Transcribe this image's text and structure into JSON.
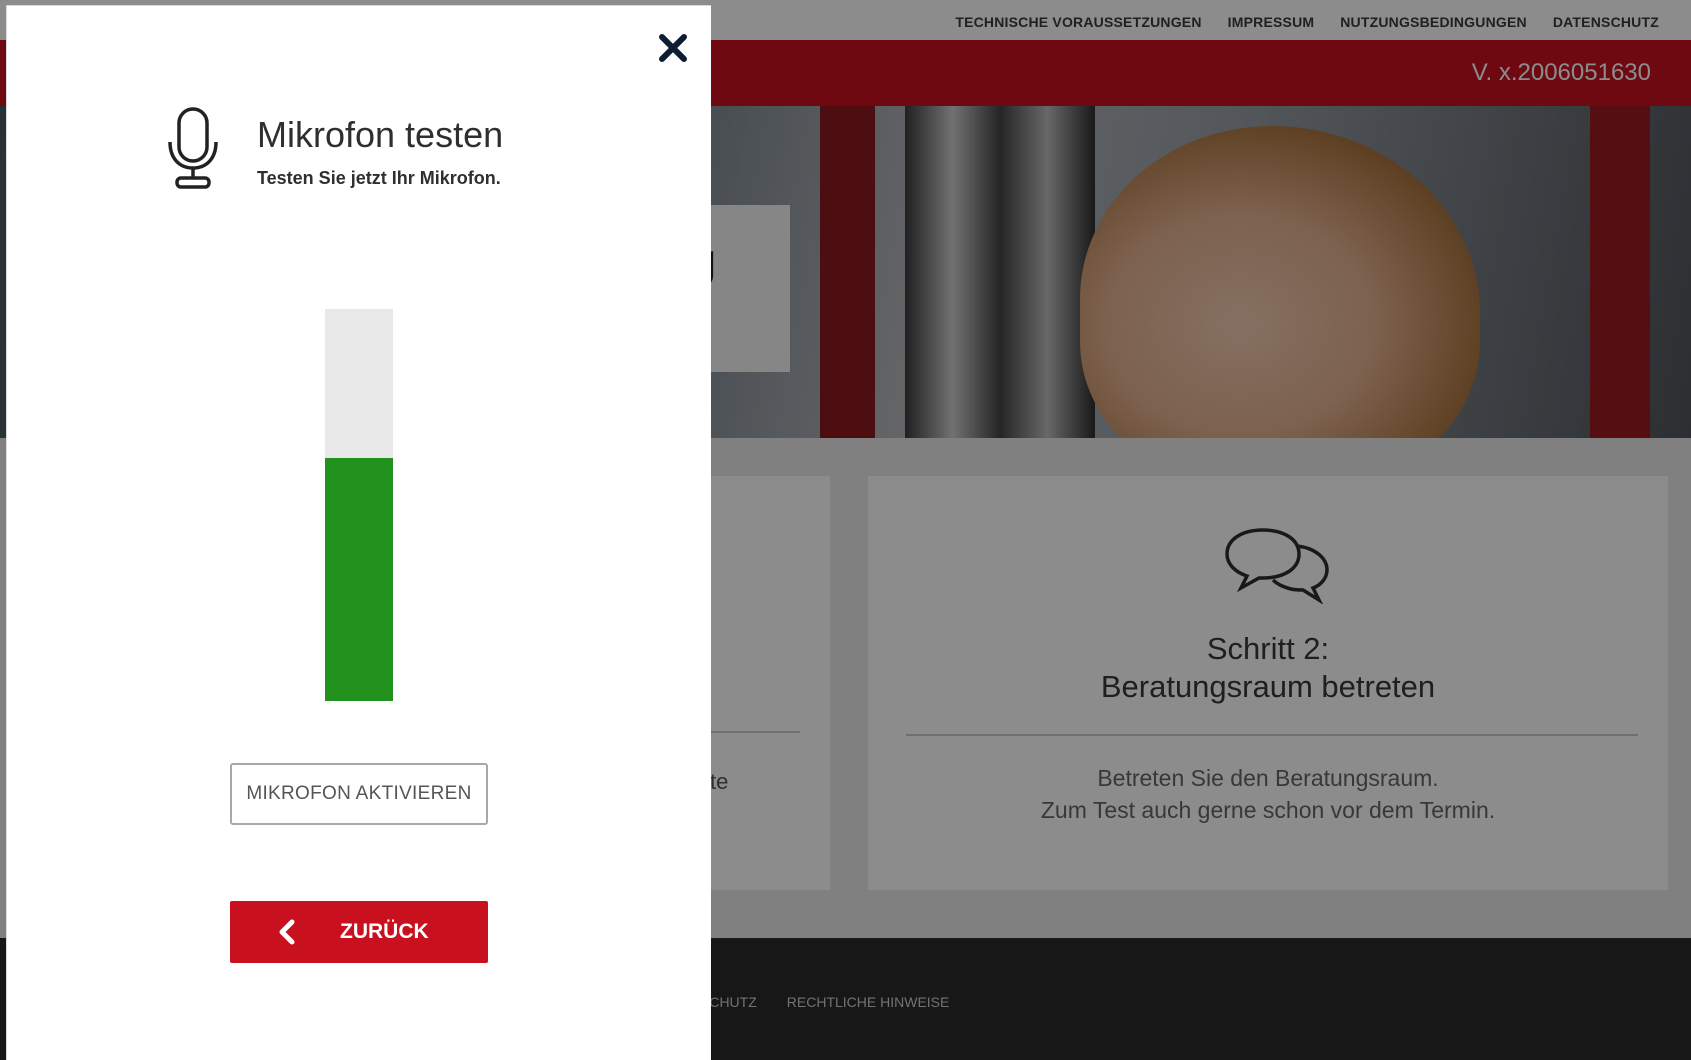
{
  "background_site": {
    "topnav": {
      "links": [
        "TECHNISCHE VORAUSSETZUNGEN",
        "IMPRESSUM",
        "NUTZUNGSBEDINGUNGEN",
        "DATENSCHUTZ"
      ]
    },
    "version": "V. x.2006051630",
    "hero_text_fragment": "ng",
    "left_card_text_fragment": "te",
    "step2": {
      "icon": "chat-bubbles-icon",
      "title_line1": "Schritt 2:",
      "title_line2": "Beratungsraum betreten",
      "desc_line1": "Betreten Sie den Beratungsraum.",
      "desc_line2": "Zum Test auch gerne schon vor dem Termin."
    },
    "footer": {
      "links": [
        "SCHUTZ",
        "RECHTLICHE HINWEISE"
      ]
    }
  },
  "panel": {
    "close_icon": "close-icon",
    "mic_icon": "microphone-icon",
    "title": "Mikrofon testen",
    "subtitle": "Testen Sie jetzt Ihr Mikrofon.",
    "level_percent": 62,
    "activate_label": "MIKROFON AKTIVIEREN",
    "back_label": "ZURÜCK",
    "back_icon": "chevron-left-icon"
  },
  "colors": {
    "accent_red": "#c8101f",
    "level_green": "#22921f",
    "level_track": "#e8e8e8"
  }
}
